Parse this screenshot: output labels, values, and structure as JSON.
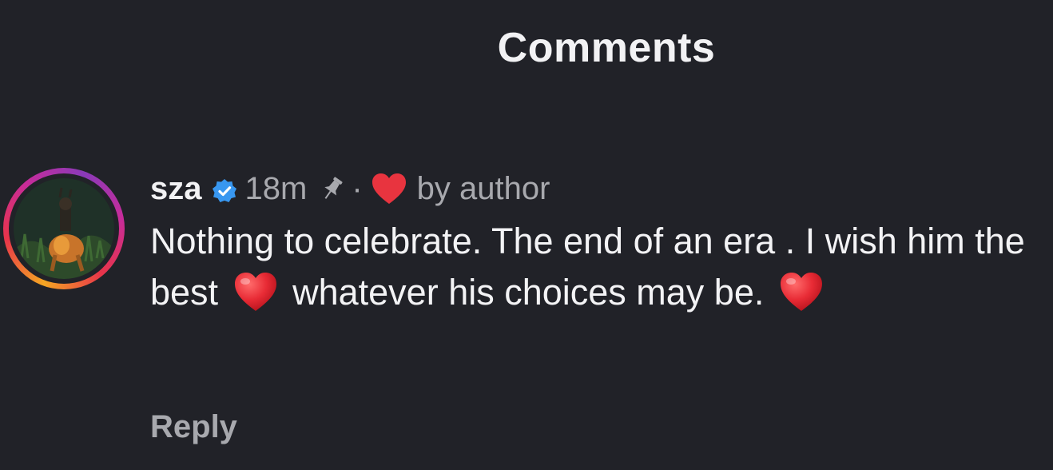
{
  "header": {
    "title": "Comments"
  },
  "comment": {
    "username": "sza",
    "verified": true,
    "time": "18m",
    "pinned": true,
    "separator": "·",
    "liked_by_author_label": "by author",
    "text_part1": "Nothing to celebrate. The end of an era . I wish him the best",
    "text_part2": "whatever his choices may be.",
    "reply_label": "Reply"
  },
  "colors": {
    "background": "#212228",
    "verified_badge": "#3897f0",
    "heart": "#e8343f",
    "muted_text": "#a8a9ae"
  },
  "icons": [
    "verified-badge-icon",
    "pin-icon",
    "heart-icon",
    "heart-emoji"
  ]
}
